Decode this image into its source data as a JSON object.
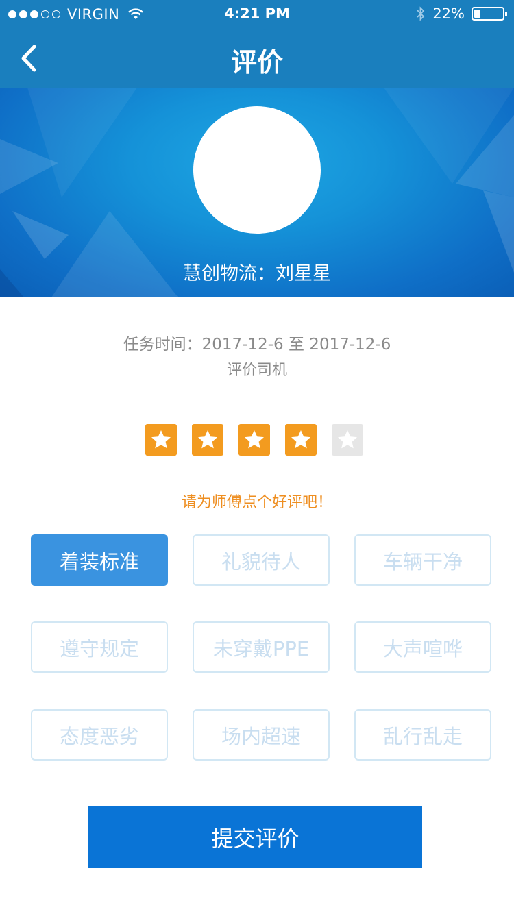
{
  "status_bar": {
    "carrier": "VIRGIN",
    "time": "4:21 PM",
    "battery_text": "22%",
    "battery_level": 0.22,
    "signal_bars_filled": 3,
    "signal_bars_total": 5
  },
  "header": {
    "title": "评价",
    "back_icon": "chevron-left-icon"
  },
  "driver": {
    "name_line": "慧创物流：刘星星"
  },
  "task": {
    "time_text": "任务时间：2017-12-6  至 2017-12-6",
    "section_label": "评价司机"
  },
  "rating": {
    "value": 4,
    "max": 5,
    "prompt": "请为师傅点个好评吧！"
  },
  "tags": [
    {
      "label": "着装标准",
      "selected": true
    },
    {
      "label": "礼貌待人",
      "selected": false
    },
    {
      "label": "车辆干净",
      "selected": false
    },
    {
      "label": "遵守规定",
      "selected": false
    },
    {
      "label": "未穿戴PPE",
      "selected": false
    },
    {
      "label": "大声喧哗",
      "selected": false
    },
    {
      "label": "态度恶劣",
      "selected": false
    },
    {
      "label": "场内超速",
      "selected": false
    },
    {
      "label": "乱行乱走",
      "selected": false
    }
  ],
  "submit_label": "提交评价",
  "colors": {
    "nav": "#1a7fbe",
    "star_on": "#f39b1f",
    "star_off": "#e6e6e6",
    "tag_active": "#3a93e0",
    "prompt": "#ee8e20",
    "submit": "#0a74d6"
  }
}
